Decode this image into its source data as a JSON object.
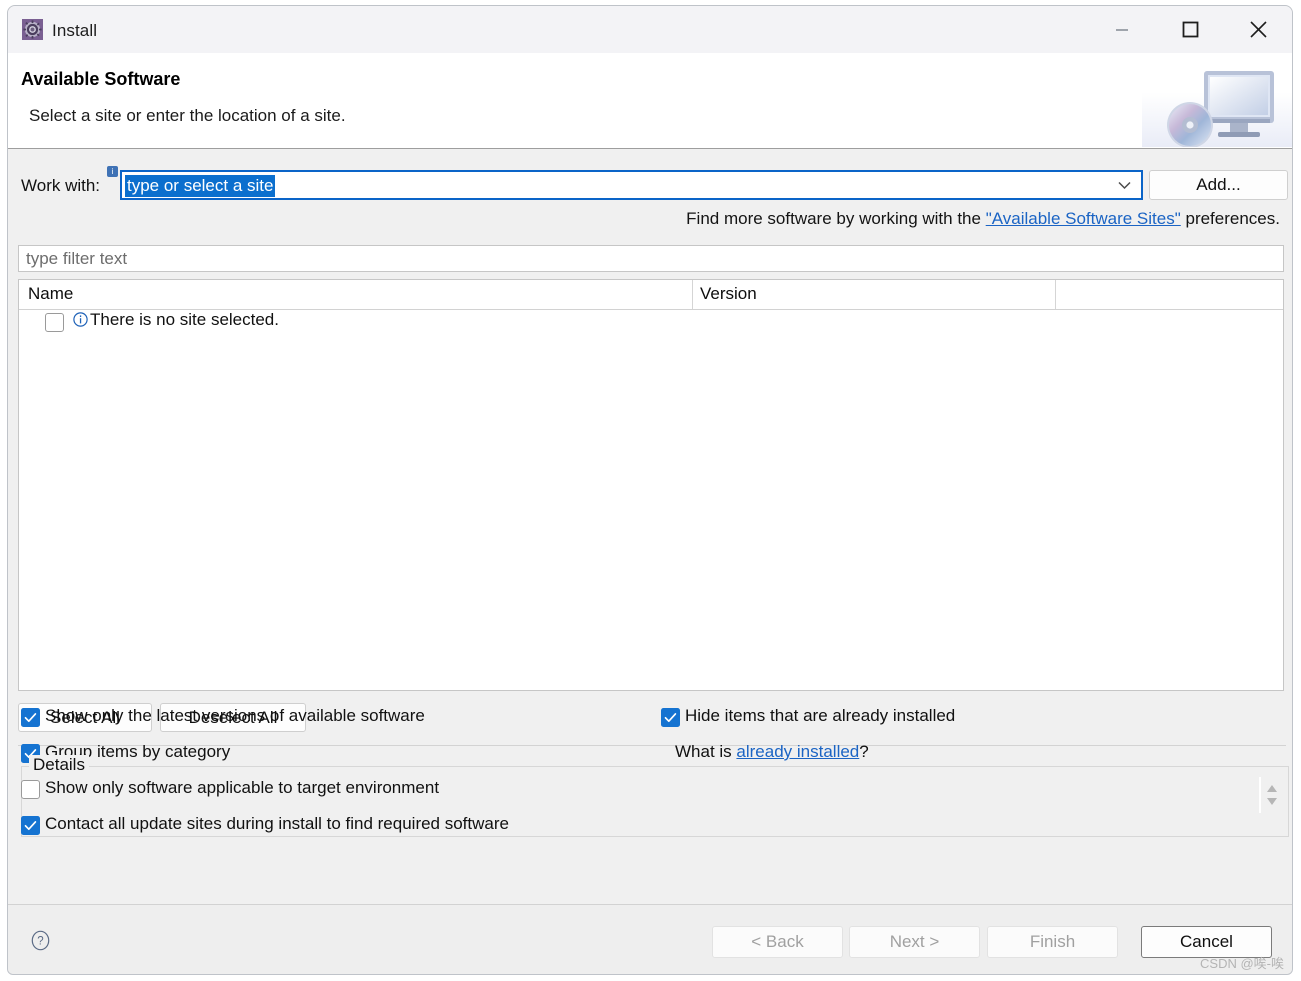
{
  "window": {
    "title": "Install",
    "icon": "install-gear-icon",
    "controls": {
      "minimize": "minimize-icon",
      "maximize": "maximize-icon",
      "close": "close-icon"
    }
  },
  "header": {
    "title": "Available Software",
    "subtitle": "Select a site or enter the location of a site.",
    "banner_icon": "monitor-disc-icon"
  },
  "work_with": {
    "label": "Work with:",
    "badge": "i",
    "value": "type or select a site",
    "placeholder": "type or select a site",
    "dropdown_icon": "chevron-down-icon",
    "add_label": "Add..."
  },
  "find_more": {
    "prefix": "Find more software by working with the ",
    "link": "\"Available Software Sites\"",
    "suffix": " preferences."
  },
  "filter": {
    "placeholder": "type filter text",
    "value": ""
  },
  "table": {
    "columns": [
      "Name",
      "Version"
    ],
    "rows": [
      {
        "checked": false,
        "icon": "info-circle-icon",
        "name": "There is no site selected.",
        "version": ""
      }
    ]
  },
  "buttons": {
    "select_all": "Select All",
    "deselect_all": "Deselect All"
  },
  "details": {
    "label": "Details",
    "content": "",
    "spinner_icon": "up-down-spinner-icon"
  },
  "options": {
    "left": [
      {
        "label": "Show only the latest versions of available software",
        "checked": true
      },
      {
        "label": "Group items by category",
        "checked": true
      },
      {
        "label": "Show only software applicable to target environment",
        "checked": false
      },
      {
        "label": "Contact all update sites during install to find required software",
        "checked": true
      }
    ],
    "right": [
      {
        "label": "Hide items that are already installed",
        "checked": true
      }
    ],
    "what_is": {
      "prefix": "What is ",
      "link": "already installed",
      "suffix": "?"
    }
  },
  "footer": {
    "help_icon": "help-circle-icon",
    "back": "< Back",
    "next": "Next >",
    "finish": "Finish",
    "cancel": "Cancel"
  },
  "watermark": "CSDN @唉-唉",
  "colors": {
    "accent": "#0b6fce",
    "link": "#1b64c4",
    "checkbox_checked": "#1573d1",
    "focus_border": "#0a64c8",
    "dialog_bg": "#f0f0f0"
  }
}
